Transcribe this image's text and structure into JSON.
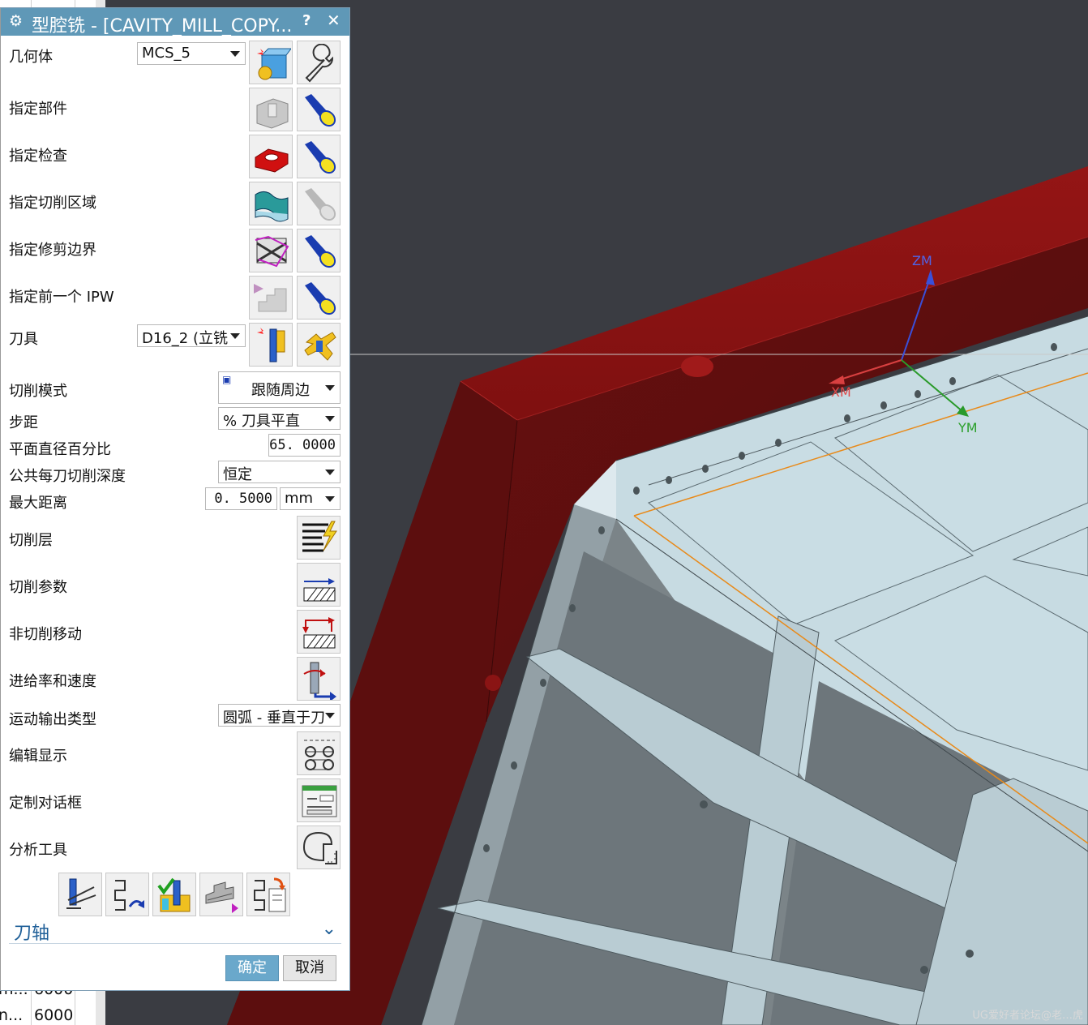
{
  "dialog": {
    "title": "型腔铣 - [CAVITY_MILL_COPY...",
    "help": "?",
    "close": "✕",
    "geometry": {
      "label": "几何体",
      "value": "MCS_5"
    },
    "specify_part": {
      "label": "指定部件"
    },
    "specify_check": {
      "label": "指定检查"
    },
    "specify_cut_area": {
      "label": "指定切削区域"
    },
    "specify_trim": {
      "label": "指定修剪边界"
    },
    "specify_ipw": {
      "label": "指定前一个 IPW"
    },
    "tool": {
      "label": "刀具",
      "value": "D16_2 (立铣"
    },
    "cut_pattern": {
      "label": "切削模式",
      "value": "跟随周边"
    },
    "stepover": {
      "label": "步距",
      "value": "% 刀具平直"
    },
    "flat_diameter_pct": {
      "label": "平面直径百分比",
      "value": "65. 0000"
    },
    "common_depth": {
      "label": "公共每刀切削深度",
      "value": "恒定"
    },
    "max_distance": {
      "label": "最大距离",
      "value": "0. 5000",
      "unit": "mm"
    },
    "cut_levels": {
      "label": "切削层"
    },
    "cut_params": {
      "label": "切削参数"
    },
    "non_cut_moves": {
      "label": "非切削移动"
    },
    "feeds_speeds": {
      "label": "进给率和速度"
    },
    "motion_output": {
      "label": "运动输出类型",
      "value": "圆弧 - 垂直于刀"
    },
    "edit_display": {
      "label": "编辑显示"
    },
    "custom_dialog": {
      "label": "定制对话框"
    },
    "analysis_tool": {
      "label": "分析工具"
    },
    "section_tool_axis": "刀轴",
    "ok": "确定",
    "cancel": "取消"
  },
  "background_table": {
    "rows": [
      {
        "name": "m...",
        "value": "6000"
      },
      {
        "name": "n...",
        "value": "6000"
      }
    ]
  },
  "viewport": {
    "axis_zm": "ZM",
    "axis_xm": "XM",
    "axis_ym": "YM",
    "watermark": "UG爱好者论坛@老…虎"
  },
  "colors": {
    "titlebar": "#5f98b7",
    "ok_button": "#6aa8cb",
    "section_text": "#1f5f98",
    "blank_red": "#7a1212",
    "part_face": "#c7dbe2",
    "viewport_bg": "#3a3c42"
  }
}
